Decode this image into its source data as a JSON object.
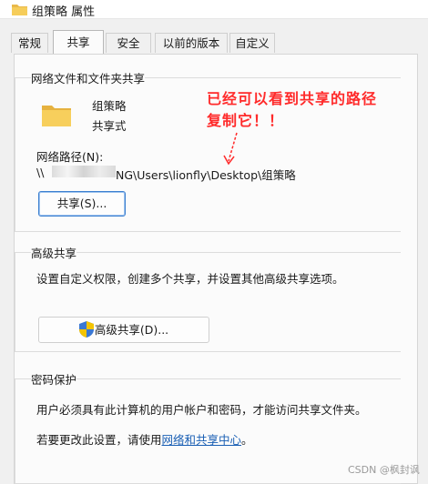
{
  "window": {
    "title": "组策略 属性"
  },
  "tabs": [
    {
      "label": "常规",
      "active": false
    },
    {
      "label": "共享",
      "active": true
    },
    {
      "label": "安全",
      "active": false
    },
    {
      "label": "以前的版本",
      "active": false
    },
    {
      "label": "自定义",
      "active": false
    }
  ],
  "network_share": {
    "heading": "网络文件和文件夹共享",
    "folder_name": "组策略",
    "share_state": "共享式",
    "path_label": "网络路径(N):",
    "path_prefix": "\\\\",
    "path_suffix": "NG\\Users\\lionfly\\Desktop\\组策略",
    "share_button": "共享(S)..."
  },
  "annotation": {
    "line1": "已经可以看到共享的路径",
    "line2": "复制它！！"
  },
  "advanced_share": {
    "heading": "高级共享",
    "description": "设置自定义权限，创建多个共享，并设置其他高级共享选项。",
    "button": "高级共享(D)..."
  },
  "password": {
    "heading": "密码保护",
    "description": "用户必须具有此计算机的用户帐户和密码，才能访问共享文件夹。",
    "change_prefix": "若要更改此设置，请使用",
    "link": "网络和共享中心",
    "change_suffix": "。"
  },
  "watermark": "CSDN @枫封讽",
  "colors": {
    "annotation": "#ff2a2a",
    "link": "#1a5fb4",
    "folder": "#f4c542"
  }
}
